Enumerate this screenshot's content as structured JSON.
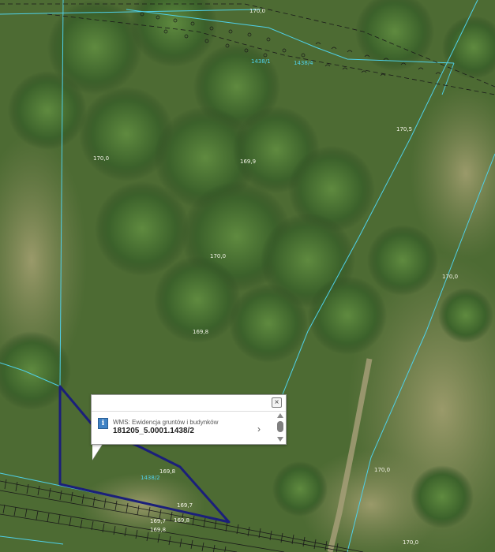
{
  "map": {
    "elevation_labels": [
      "170,0",
      "170,5",
      "170,0",
      "169,9",
      "170,0",
      "170,0",
      "169,8",
      "170,0",
      "169,8",
      "169,7",
      "169,7",
      "169,8",
      "169,8",
      "170,0"
    ],
    "plot_labels": [
      "1438/1",
      "1438/2",
      "1438/4"
    ],
    "colors": {
      "parcel_lines": "#4fd0e8",
      "selected_parcel": "#1b1f7a",
      "vegetation_dark": "#2f4f22",
      "vegetation_light": "#7d8a55"
    }
  },
  "popup": {
    "layer_name": "WMS: Ewidencja gruntów i budynków",
    "parcel_id": "181205_5.0001.1438/2",
    "close_icon": "close-icon",
    "info_icon": "info-icon",
    "next_icon": "chevron-right-icon",
    "close_symbol": "×",
    "info_symbol": "i",
    "next_symbol": "›"
  }
}
